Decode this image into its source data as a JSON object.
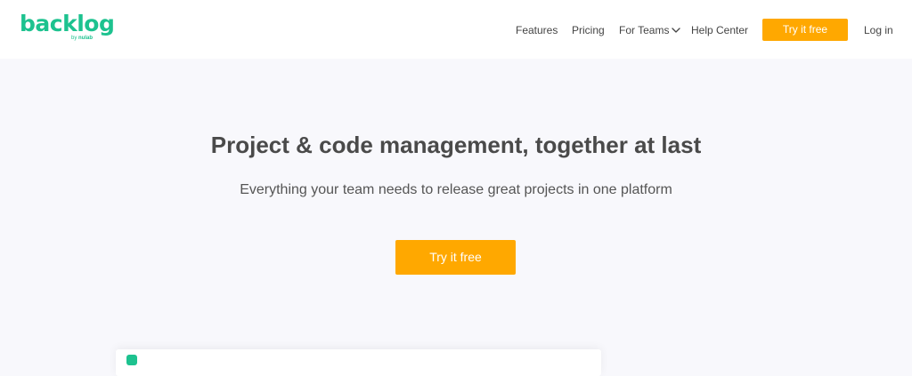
{
  "brand": {
    "name": "backlog",
    "byline_prefix": "by",
    "byline_company": "nulab",
    "color": "#1dc28f"
  },
  "nav": {
    "items": [
      {
        "label": "Features"
      },
      {
        "label": "Pricing"
      },
      {
        "label": "For Teams",
        "icon": "chevron-down-icon"
      },
      {
        "label": "Help Center"
      }
    ],
    "cta_label": "Try it free",
    "login_label": "Log in"
  },
  "hero": {
    "title": "Project & code management, together at last",
    "subtitle": "Everything your team needs to release great projects in one platform",
    "cta_label": "Try it free"
  },
  "colors": {
    "accent": "#ffa800",
    "brand": "#1dc28f",
    "background": "#f8f8fc",
    "text": "#4a4a4a"
  }
}
